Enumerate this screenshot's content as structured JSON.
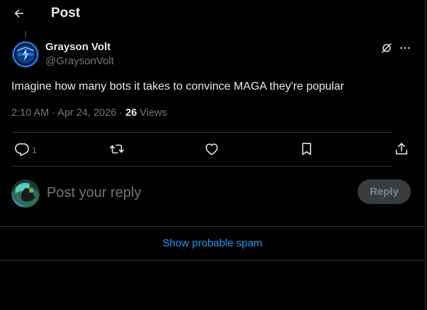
{
  "header": {
    "title": "Post",
    "back_icon": "arrow-left-icon"
  },
  "post": {
    "author": {
      "name": "Grayson Volt",
      "handle": "@GraysonVolt",
      "avatar_text": "GRAYSON VOLT",
      "avatar_color": "#1e6fd9"
    },
    "text": "Imagine how many bots it takes to convince MAGA they're popular",
    "timestamp": "2:10 AM · Apr 24, 2026 · ",
    "views_count": "26",
    "views_label": " Views",
    "actions": {
      "reply_count": "1",
      "icons": [
        "reply-icon",
        "repost-icon",
        "like-icon",
        "bookmark-icon",
        "share-icon"
      ]
    }
  },
  "composer": {
    "placeholder": "Post your reply",
    "button_label": "Reply"
  },
  "spam": {
    "label": "Show probable spam"
  },
  "colors": {
    "background": "#000000",
    "text": "#e7e9ea",
    "muted": "#71767b",
    "accent": "#1d9bf0",
    "divider": "#2f3336"
  }
}
